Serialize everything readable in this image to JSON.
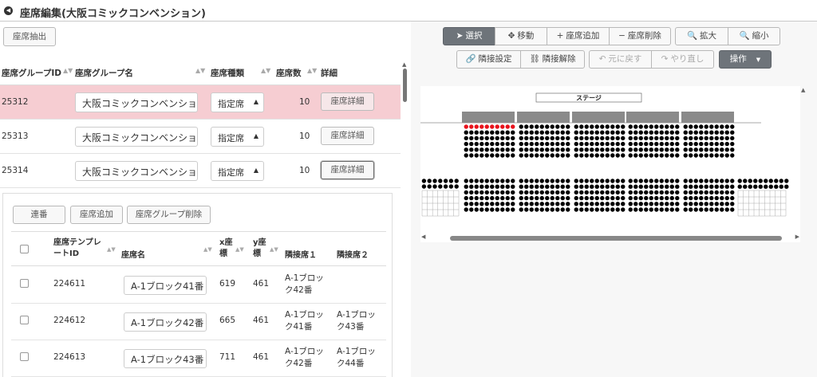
{
  "header": {
    "title": "座席編集(大阪コミックコンベンション)"
  },
  "left": {
    "extract_button": "座席抽出",
    "group_table": {
      "columns": [
        "座席グループID",
        "座席グループ名",
        "座席種類",
        "座席数",
        "詳細"
      ],
      "rows": [
        {
          "id": "25312",
          "name": "大阪コミックコンベンション",
          "type": "指定席",
          "count": "10",
          "detail": "座席詳細",
          "selected": true
        },
        {
          "id": "25313",
          "name": "大阪コミックコンベンション",
          "type": "指定席",
          "count": "10",
          "detail": "座席詳細",
          "selected": false
        },
        {
          "id": "25314",
          "name": "大阪コミックコンベンション",
          "type": "指定席",
          "count": "10",
          "detail": "座席詳細",
          "selected": false
        }
      ]
    },
    "sub": {
      "buttons": {
        "renban": "連番",
        "add_seat": "座席追加",
        "delete_group": "座席グループ削除"
      },
      "columns": {
        "template_id_1": "座席テンプレ",
        "template_id_2": "ートID",
        "seat_name": "座席名",
        "x_1": "x座",
        "x_2": "標",
        "y_1": "y座",
        "y_2": "標",
        "adj1": "隣接席１",
        "adj2": "隣接席２"
      },
      "rows": [
        {
          "id": "224611",
          "name": "A-1ブロック41番",
          "x": "619",
          "y": "461",
          "adj1a": "A-1ブロッ",
          "adj1b": "ク42番",
          "adj2a": "",
          "adj2b": ""
        },
        {
          "id": "224612",
          "name": "A-1ブロック42番",
          "x": "665",
          "y": "461",
          "adj1a": "A-1ブロッ",
          "adj1b": "ク41番",
          "adj2a": "A-1ブロッ",
          "adj2b": "ク43番"
        },
        {
          "id": "224613",
          "name": "A-1ブロック43番",
          "x": "711",
          "y": "461",
          "adj1a": "A-1ブロッ",
          "adj1b": "ク42番",
          "adj2a": "A-1ブロッ",
          "adj2b": "ク44番"
        }
      ]
    }
  },
  "toolbar": {
    "select": "選択",
    "move": "移動",
    "add_seat": "座席追加",
    "delete_seat": "座席削除",
    "zoom_in": "拡大",
    "zoom_out": "縮小",
    "adj_set": "隣接設定",
    "adj_clear": "隣接解除",
    "undo": "元に戻す",
    "redo": "やり直し",
    "operations": "操作"
  },
  "map": {
    "stage_label": "ステージ",
    "colors": {
      "seat": "#000000",
      "selected": "#e8121c",
      "header_cell": "#8a8a8a"
    }
  }
}
